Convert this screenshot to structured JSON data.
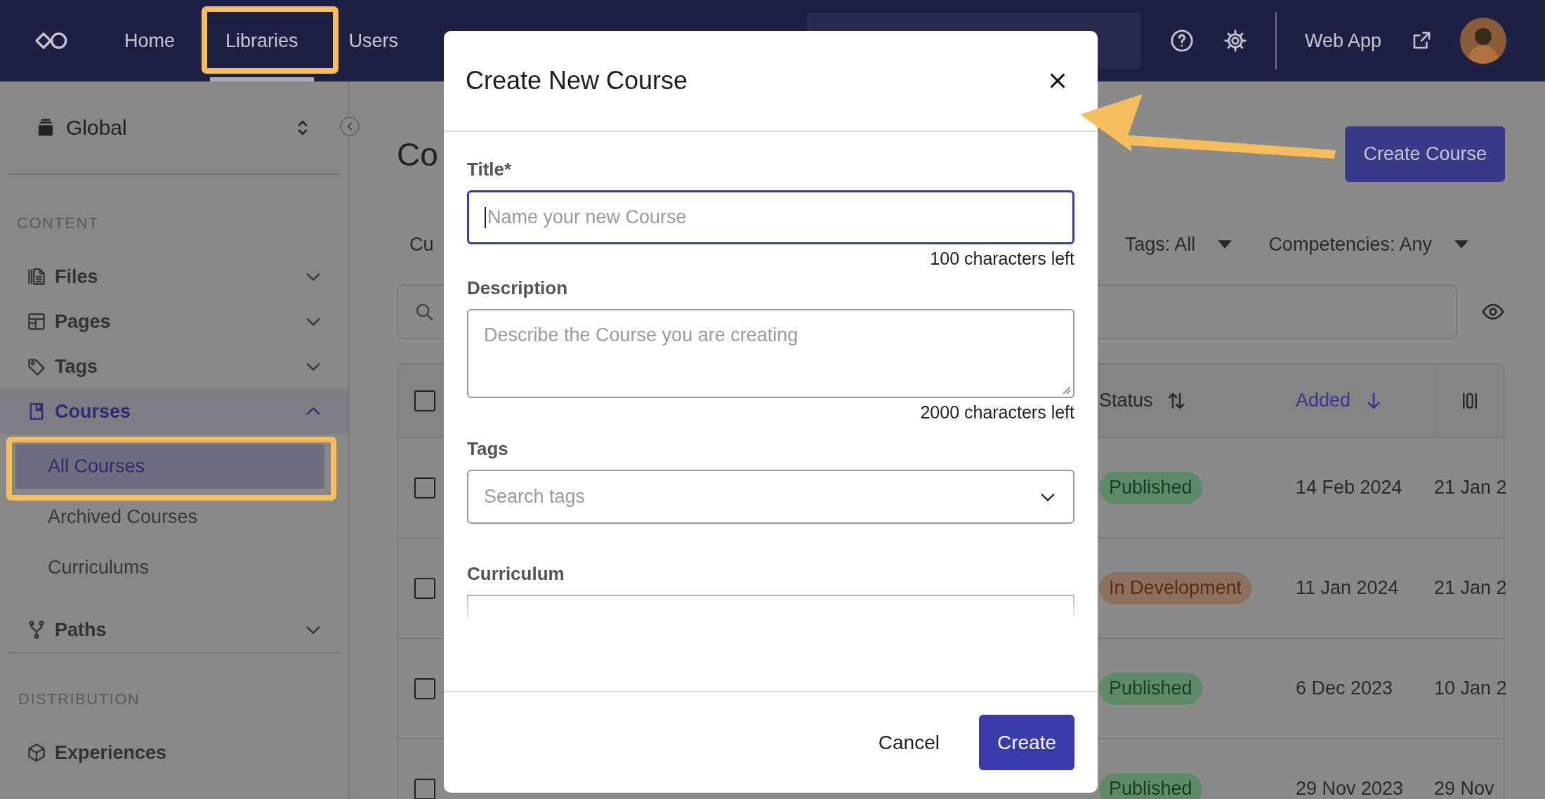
{
  "top_bar": {
    "nav": [
      {
        "label": "Home",
        "selected": false
      },
      {
        "label": "Libraries",
        "selected": true
      },
      {
        "label": "Users",
        "selected": false
      }
    ],
    "web_app_link": "Web App"
  },
  "sidebar": {
    "scope": "Global",
    "sections": [
      {
        "heading": "CONTENT",
        "items": [
          {
            "label": "Files",
            "kind": "group",
            "expanded": false,
            "selected": false
          },
          {
            "label": "Pages",
            "kind": "group",
            "expanded": false,
            "selected": false
          },
          {
            "label": "Tags",
            "kind": "group",
            "expanded": false,
            "selected": false
          },
          {
            "label": "Courses",
            "kind": "group",
            "expanded": true,
            "selected": true,
            "children": [
              {
                "label": "All Courses",
                "selected": true
              },
              {
                "label": "Archived Courses",
                "selected": false
              },
              {
                "label": "Curriculums",
                "selected": false
              }
            ]
          },
          {
            "label": "Paths",
            "kind": "group",
            "expanded": false,
            "selected": false
          }
        ]
      },
      {
        "heading": "DISTRIBUTION",
        "items": [
          {
            "label": "Experiences",
            "kind": "link",
            "selected": false
          }
        ]
      }
    ]
  },
  "main": {
    "title": "Co",
    "create_button": "Create Course",
    "filters": [
      {
        "label": "Cu",
        "dropdown": false
      },
      {
        "label": "Tags: All",
        "dropdown": true
      },
      {
        "label": "Competencies: Any",
        "dropdown": true
      }
    ],
    "table": {
      "select_all": {
        "checked": false
      },
      "columns": [
        {
          "label": "Status",
          "kind": "unsorted"
        },
        {
          "label": "Added",
          "kind": "descending"
        }
      ],
      "rows": [
        {
          "checked": false,
          "status": {
            "label": "Published",
            "kind": "published"
          },
          "added": "14 Feb 2024",
          "column_4": "21 Jan 2"
        },
        {
          "checked": false,
          "status": {
            "label": "In Development",
            "kind": "development"
          },
          "added": "11 Jan 2024",
          "column_4": "21 Jan 2"
        },
        {
          "checked": false,
          "status": {
            "label": "Published",
            "kind": "published"
          },
          "added": "6 Dec 2023",
          "column_4": "10 Jan 2"
        },
        {
          "checked": false,
          "status": {
            "label": "Published",
            "kind": "published"
          },
          "added": "29 Nov 2023",
          "column_4": "29 Nov"
        }
      ]
    }
  },
  "dialog": {
    "title": "Create New Course",
    "fields": [
      {
        "kind": "text",
        "label": "Title*",
        "placeholder": "Name your new Course",
        "focused": true,
        "counter": "100 characters left"
      },
      {
        "kind": "textarea",
        "label": "Description",
        "placeholder": "Describe the Course you are creating",
        "focused": false,
        "counter": "2000 characters left"
      },
      {
        "kind": "select",
        "label": "Tags",
        "placeholder": "Search tags",
        "focused": false
      },
      {
        "kind": "faded",
        "label": "Curriculum",
        "focused": false
      }
    ],
    "buttons": [
      {
        "label": "Cancel",
        "kind": "secondary"
      },
      {
        "label": "Create",
        "kind": "primary"
      }
    ]
  }
}
